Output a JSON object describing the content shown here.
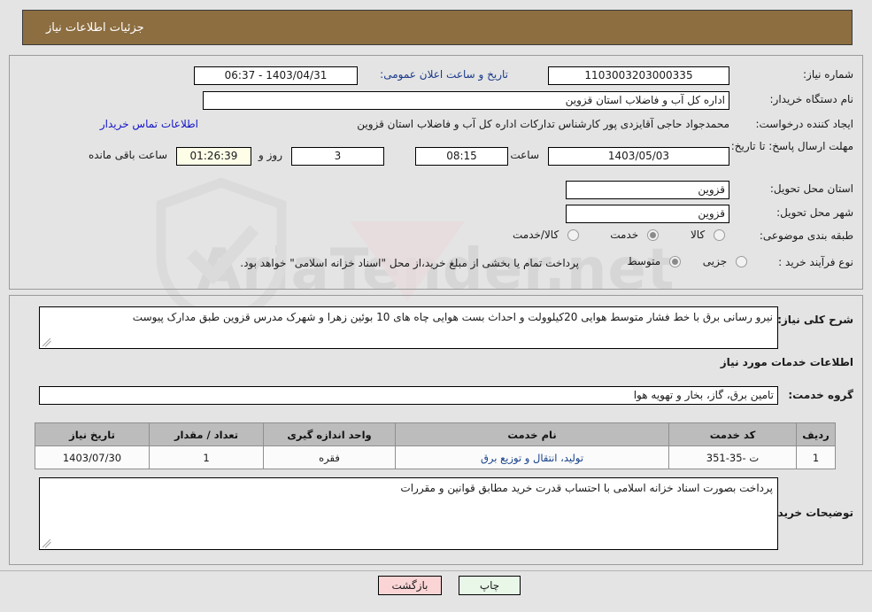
{
  "header": {
    "title": "جزئیات اطلاعات نیاز",
    "bar_color": "#8d6e41"
  },
  "watermark": {
    "text": "AriaTender.net"
  },
  "form": {
    "need_number": {
      "label": "شماره نیاز:",
      "value": "1103003203000335"
    },
    "announce_datetime": {
      "label": "تاریخ و ساعت اعلان عمومی:",
      "value": "1403/04/31 - 06:37"
    },
    "buyer_org": {
      "label": "نام دستگاه خریدار:",
      "value": "اداره کل آب و فاضلاب استان قزوین"
    },
    "request_creator": {
      "label": "ایجاد کننده درخواست:",
      "value": "محمدجواد حاجی آقایزدی پور کارشناس تدارکات اداره کل آب و فاضلاب استان قزوین",
      "contact_link": "اطلاعات تماس خریدار"
    },
    "deadline": {
      "label": "مهلت ارسال پاسخ: تا تاریخ:",
      "date": "1403/05/03",
      "time_label": "ساعت",
      "time": "08:15",
      "days": "3",
      "days_label": "روز و",
      "countdown": "01:26:39",
      "countdown_label": "ساعت باقی مانده"
    },
    "delivery_province": {
      "label": "استان محل تحویل:",
      "value": "قزوین"
    },
    "delivery_city": {
      "label": "شهر محل تحویل:",
      "value": "قزوین"
    },
    "subject_category": {
      "label": "طبقه بندی موضوعی:",
      "options": [
        "کالا",
        "خدمت",
        "کالا/خدمت"
      ],
      "selected": "خدمت"
    },
    "purchase_type": {
      "label": "نوع فرآیند خرید :",
      "options": [
        "جزیی",
        "متوسط"
      ],
      "selected": "متوسط",
      "note": "پرداخت تمام یا بخشی از مبلغ خرید،از محل \"اسناد خزانه اسلامی\" خواهد بود."
    }
  },
  "need_summary": {
    "label": "شرح کلی نیاز:",
    "value": "نیرو رسانی برق با خط فشار متوسط هوایی 20کیلوولت  و احداث بست هوایی چاه های 10 بوئین زهرا و شهرک مدرس  قزوین طبق مدارک پیوست"
  },
  "services_section": {
    "heading": "اطلاعات خدمات مورد نیاز",
    "service_group": {
      "label": "گروه خدمت:",
      "value": "تامین برق، گاز، بخار و تهویه هوا"
    },
    "table": {
      "columns": [
        "ردیف",
        "کد خدمت",
        "نام خدمت",
        "واحد اندازه گیری",
        "تعداد / مقدار",
        "تاریخ نیاز"
      ],
      "rows": [
        {
          "row_no": "1",
          "service_code": "ت -35-351",
          "service_name": "تولید، انتقال و توزیع برق",
          "unit": "فقره",
          "quantity": "1",
          "need_date": "1403/07/30"
        }
      ]
    }
  },
  "buyer_notes": {
    "label": "توضیحات خریدار:",
    "value": "پرداخت بصورت اسناد خزانه اسلامی با احتساب قدرت خرید مطابق قوانین و مقررات"
  },
  "footer": {
    "print_button": "چاپ",
    "back_button": "بازگشت"
  }
}
